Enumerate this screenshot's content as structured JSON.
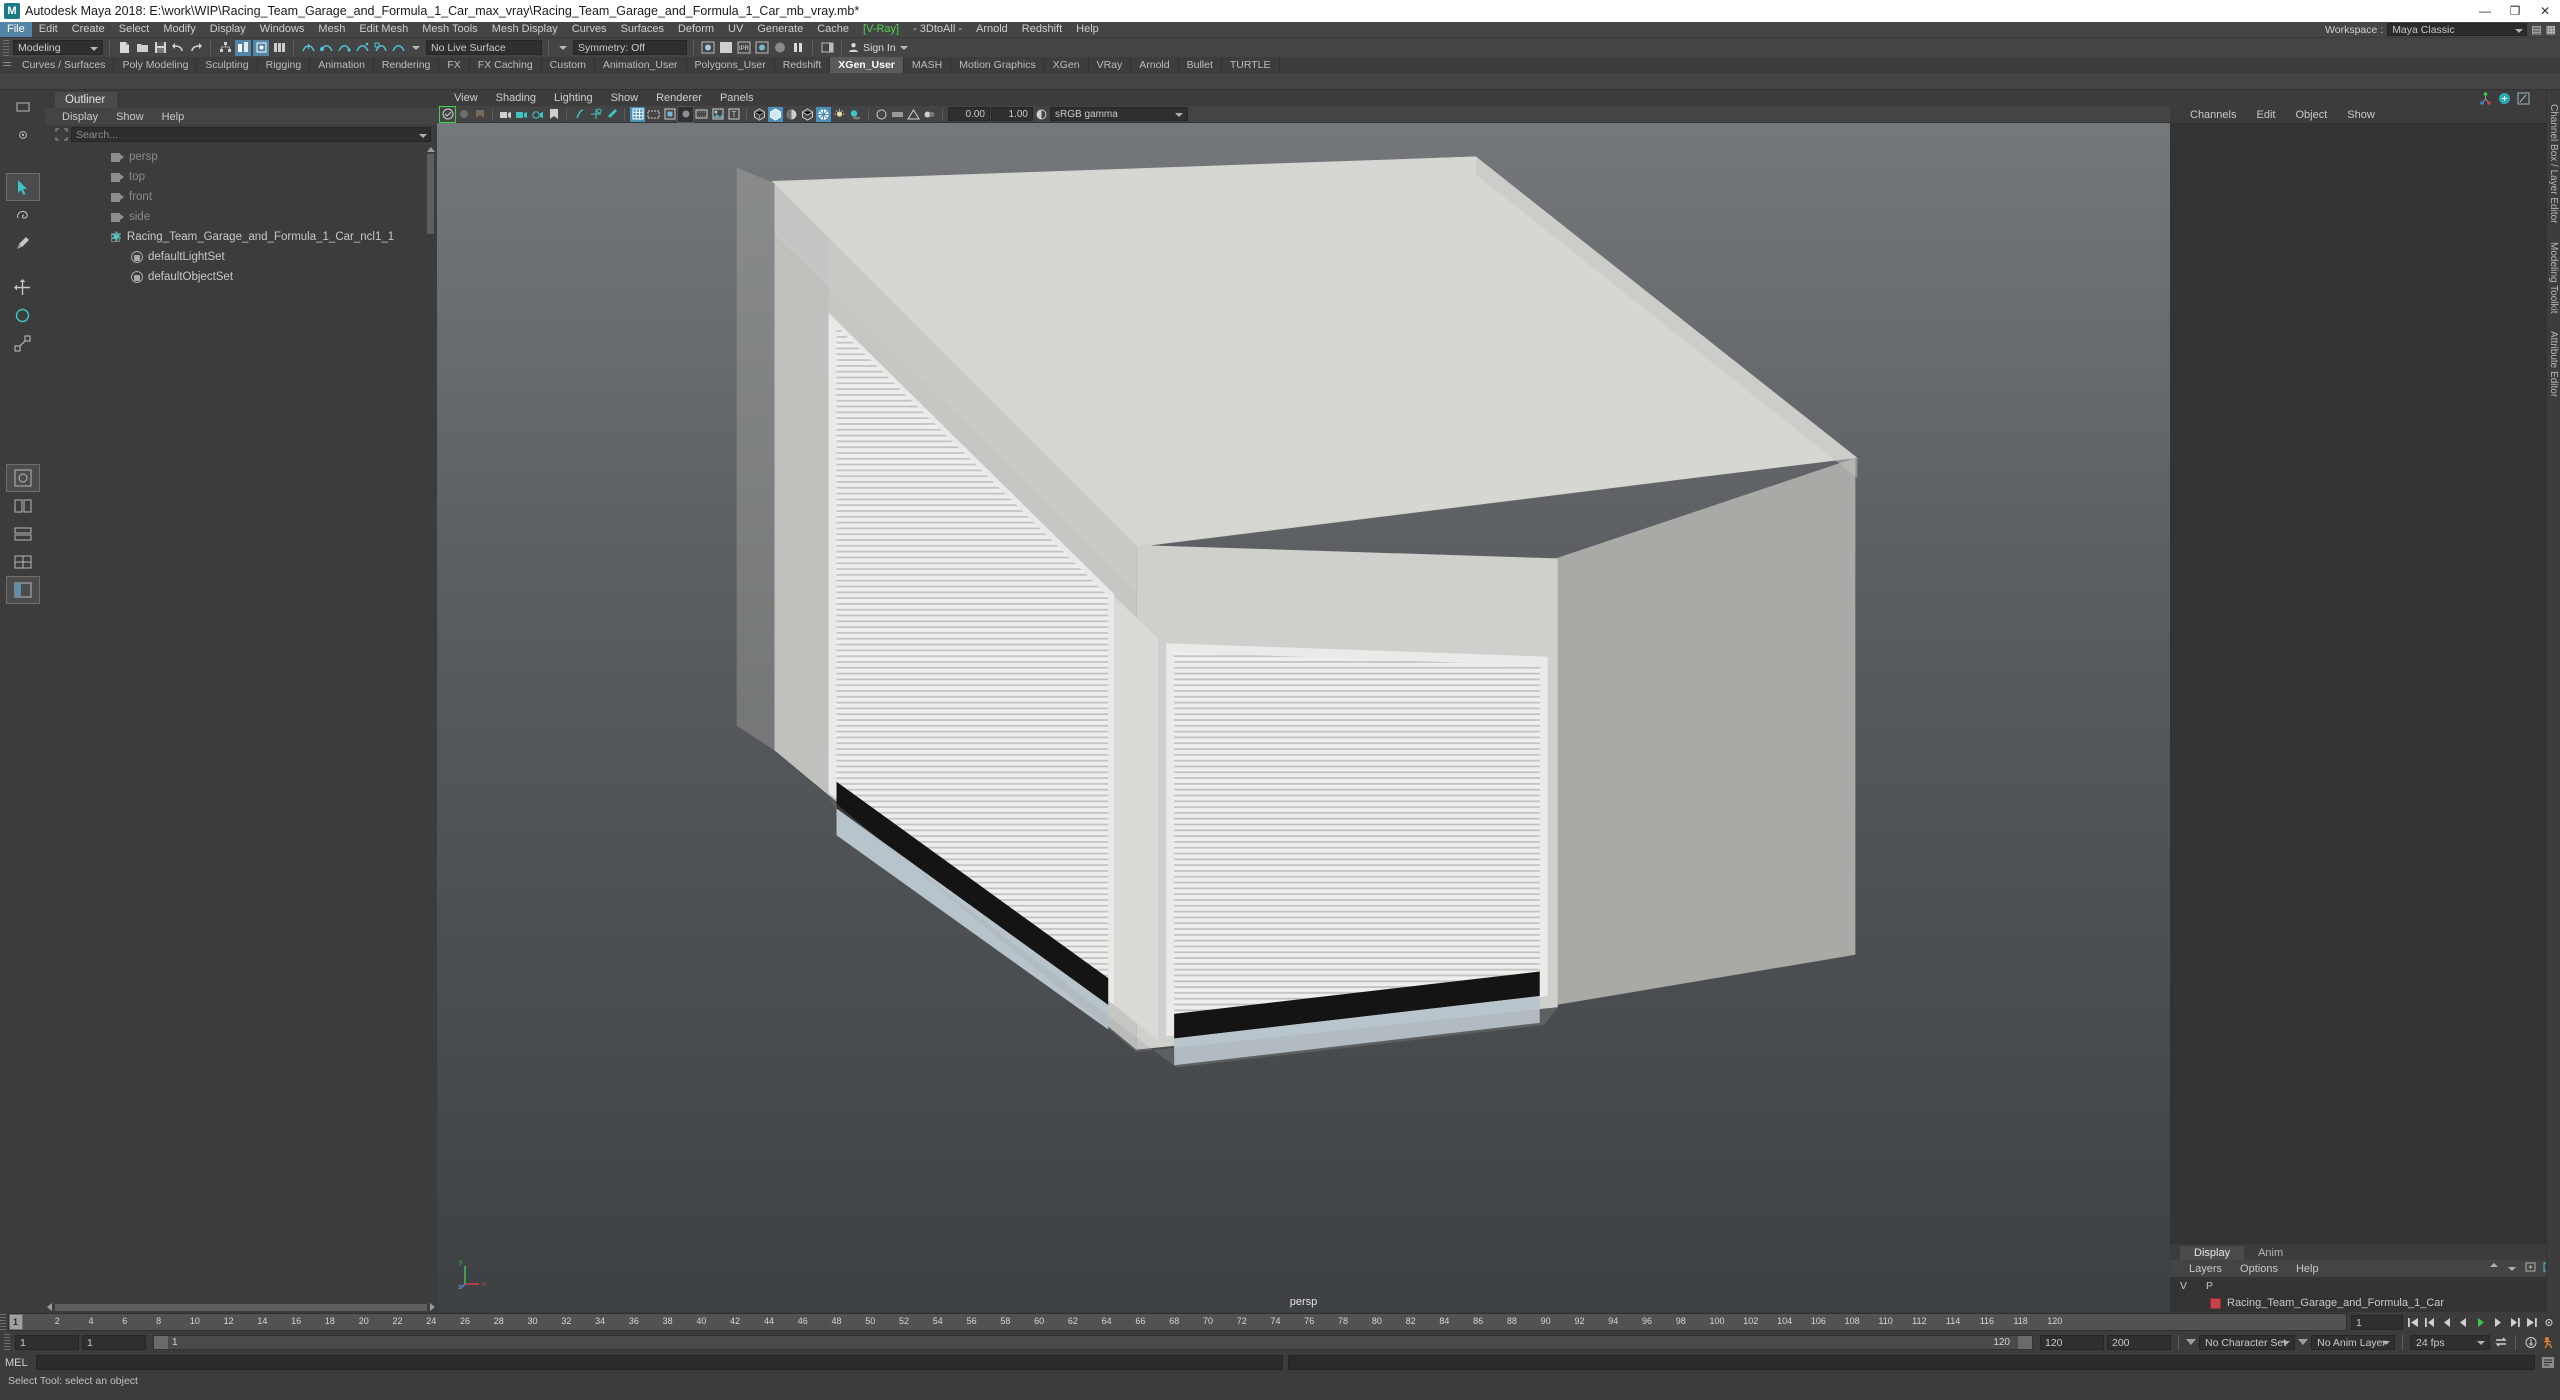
{
  "titlebar": {
    "app_title": "Autodesk Maya 2018: E:\\work\\WIP\\Racing_Team_Garage_and_Formula_1_Car_max_vray\\Racing_Team_Garage_and_Formula_1_Car_mb_vray.mb*",
    "logo": "M",
    "minimize": "—",
    "maximize": "❐",
    "close": "✕"
  },
  "menubar": {
    "items": [
      {
        "label": "File",
        "active": true
      },
      {
        "label": "Edit",
        "active": false
      },
      {
        "label": "Create",
        "active": false
      },
      {
        "label": "Select",
        "active": false
      },
      {
        "label": "Modify",
        "active": false
      },
      {
        "label": "Display",
        "active": false
      },
      {
        "label": "Windows",
        "active": false
      },
      {
        "label": "Mesh",
        "active": false
      },
      {
        "label": "Edit Mesh",
        "active": false
      },
      {
        "label": "Mesh Tools",
        "active": false
      },
      {
        "label": "Mesh Display",
        "active": false
      },
      {
        "label": "Curves",
        "active": false
      },
      {
        "label": "Surfaces",
        "active": false
      },
      {
        "label": "Deform",
        "active": false
      },
      {
        "label": "UV",
        "active": false
      },
      {
        "label": "Generate",
        "active": false
      },
      {
        "label": "Cache",
        "active": false
      },
      {
        "label": "[V-Ray]",
        "active": false
      },
      {
        "label": "- 3DtoAll -",
        "active": false
      },
      {
        "label": "Arnold",
        "active": false
      },
      {
        "label": "Redshift",
        "active": false
      },
      {
        "label": "Help",
        "active": false
      }
    ],
    "workspace_label": "Workspace :",
    "workspace_value": "Maya Classic"
  },
  "statusbar": {
    "mode": "Modeling",
    "live_surface": "No Live Surface",
    "symmetry": "Symmetry: Off",
    "signin": "Sign In"
  },
  "shelf": {
    "tabs": [
      {
        "label": "Curves / Surfaces",
        "active": false
      },
      {
        "label": "Poly Modeling",
        "active": false
      },
      {
        "label": "Sculpting",
        "active": false
      },
      {
        "label": "Rigging",
        "active": false
      },
      {
        "label": "Animation",
        "active": false
      },
      {
        "label": "Rendering",
        "active": false
      },
      {
        "label": "FX",
        "active": false
      },
      {
        "label": "FX Caching",
        "active": false
      },
      {
        "label": "Custom",
        "active": false
      },
      {
        "label": "Animation_User",
        "active": false
      },
      {
        "label": "Polygons_User",
        "active": false
      },
      {
        "label": "Redshift",
        "active": false
      },
      {
        "label": "XGen_User",
        "active": true
      },
      {
        "label": "MASH",
        "active": false
      },
      {
        "label": "Motion Graphics",
        "active": false
      },
      {
        "label": "XGen",
        "active": false
      },
      {
        "label": "VRay",
        "active": false
      },
      {
        "label": "Arnold",
        "active": false
      },
      {
        "label": "Bullet",
        "active": false
      },
      {
        "label": "TURTLE",
        "active": false
      }
    ]
  },
  "outliner": {
    "tab_title": "Outliner",
    "menus": [
      "Display",
      "Show",
      "Help"
    ],
    "search_placeholder": "Search...",
    "items": [
      {
        "label": "persp",
        "icon": "camera-icon",
        "dim": true,
        "expandable": true,
        "indent": 0
      },
      {
        "label": "top",
        "icon": "camera-icon",
        "dim": true,
        "expandable": true,
        "indent": 0
      },
      {
        "label": "front",
        "icon": "camera-icon",
        "dim": true,
        "expandable": true,
        "indent": 0
      },
      {
        "label": "side",
        "icon": "camera-icon",
        "dim": true,
        "expandable": true,
        "indent": 0
      },
      {
        "label": "Racing_Team_Garage_and_Formula_1_Car_ncl1_1",
        "icon": "group-star-icon",
        "dim": false,
        "expandable": true,
        "indent": 0
      },
      {
        "label": "defaultLightSet",
        "icon": "set-icon",
        "dim": false,
        "expandable": false,
        "indent": 1
      },
      {
        "label": "defaultObjectSet",
        "icon": "set-icon",
        "dim": false,
        "expandable": false,
        "indent": 1
      }
    ]
  },
  "viewport": {
    "menus": [
      "View",
      "Shading",
      "Lighting",
      "Show",
      "Renderer",
      "Panels"
    ],
    "exposure": "0.00",
    "gamma_value": "1.00",
    "color_profile": "sRGB gamma",
    "camera_label": "persp"
  },
  "channelbox": {
    "tab_title": "Channels",
    "menus": [
      "Channels",
      "Edit",
      "Object",
      "Show"
    ],
    "side_labels": [
      "Channel Box / Layer Editor",
      "Modeling Toolkit",
      "Attribute Editor"
    ]
  },
  "layereditor": {
    "tabs": [
      {
        "label": "Display",
        "active": true
      },
      {
        "label": "Anim",
        "active": false
      }
    ],
    "menus": [
      "Layers",
      "Options",
      "Help"
    ],
    "col_v": "V",
    "col_p": "P",
    "layers": [
      {
        "name": "Racing_Team_Garage_and_Formula_1_Car",
        "color": "#c8414b"
      }
    ]
  },
  "timeslider": {
    "ticks": [
      "2",
      "4",
      "6",
      "8",
      "10",
      "12",
      "14",
      "16",
      "18",
      "20",
      "22",
      "24",
      "26",
      "28",
      "30",
      "32",
      "34",
      "36",
      "38",
      "40",
      "42",
      "44",
      "46",
      "48",
      "50",
      "52",
      "54",
      "56",
      "58",
      "60",
      "62",
      "64",
      "66",
      "68",
      "70",
      "72",
      "74",
      "76",
      "78",
      "80",
      "82",
      "84",
      "86",
      "88",
      "90",
      "92",
      "94",
      "96",
      "98",
      "100",
      "102",
      "104",
      "106",
      "108",
      "110",
      "112",
      "114",
      "116",
      "118",
      "120"
    ],
    "current_frame": "1",
    "frame_field": "1"
  },
  "rangeslider": {
    "start": "1",
    "end": "1",
    "bar_start": "1",
    "bar_end": "120",
    "anim_start": "120",
    "anim_end": "200",
    "character_set": "No Character Set",
    "anim_layer": "No Anim Layer",
    "fps": "24 fps"
  },
  "commandline": {
    "label": "MEL",
    "input_value": "",
    "output_value": ""
  },
  "helpline": {
    "text": "Select Tool: select an object"
  },
  "colors": {
    "accent_blue": "#5285a6",
    "teal": "#3fc4c4",
    "layer_red": "#c8414b",
    "window_bg": "#3c3c3c",
    "panel_bg": "#333333"
  }
}
